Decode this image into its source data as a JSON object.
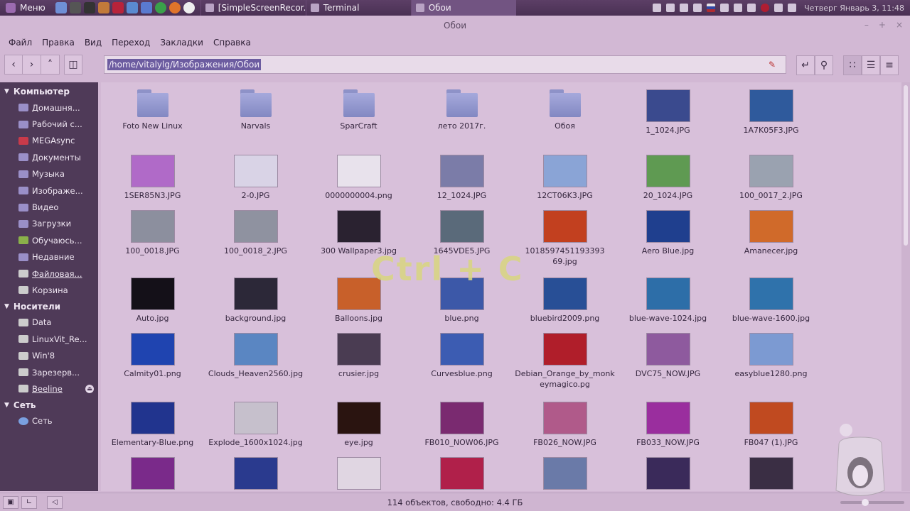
{
  "panel": {
    "menu_label": "Меню",
    "tasks": [
      {
        "label": "[SimpleScreenRecor..."
      },
      {
        "label": "Terminal"
      },
      {
        "label": "Обои"
      }
    ],
    "clock": "Четверг Январь 3, 11:48"
  },
  "window": {
    "title": "Обои",
    "controls": [
      "–",
      "+",
      "×"
    ]
  },
  "menubar": [
    "Файл",
    "Правка",
    "Вид",
    "Переход",
    "Закладки",
    "Справка"
  ],
  "toolbar": {
    "path": "/home/vitalylg/Изображения/Обои"
  },
  "sidebar": {
    "sections": [
      {
        "title": "Компьютер",
        "items": [
          "Домашня...",
          "Рабочий с...",
          "MEGAsync",
          "Документы",
          "Музыка",
          "Изображе...",
          "Видео",
          "Загрузки",
          "Обучаюсь...",
          "Недавние",
          "Файловая...",
          "Корзина"
        ]
      },
      {
        "title": "Носители",
        "items": [
          "Data",
          "LinuxVit_Re...",
          "Win'8",
          "Зарезерв...",
          "Beeline"
        ]
      },
      {
        "title": "Сеть",
        "items": [
          "Сеть"
        ]
      }
    ]
  },
  "files": [
    {
      "name": "Foto New Linux",
      "kind": "folder"
    },
    {
      "name": "Narvals",
      "kind": "folder"
    },
    {
      "name": "SparCraft",
      "kind": "folder"
    },
    {
      "name": "лето 2017г.",
      "kind": "folder"
    },
    {
      "name": "Обоя",
      "kind": "folder"
    },
    {
      "name": "1_1024.JPG",
      "kind": "image",
      "color": "#3a4a8e"
    },
    {
      "name": "1A7K05F3.JPG",
      "kind": "image",
      "color": "#2f5a9c"
    },
    {
      "name": "1SER85N3.JPG",
      "kind": "image",
      "color": "#b06ac8"
    },
    {
      "name": "2-0.JPG",
      "kind": "image",
      "color": "#d9d3e6"
    },
    {
      "name": "0000000004.png",
      "kind": "image",
      "color": "#e8e2ec"
    },
    {
      "name": "12_1024.JPG",
      "kind": "image",
      "color": "#7b7ca8"
    },
    {
      "name": "12CT06K3.JPG",
      "kind": "image",
      "color": "#8aa4d6"
    },
    {
      "name": "20_1024.JPG",
      "kind": "image",
      "color": "#5f9a52"
    },
    {
      "name": "100_0017_2.JPG",
      "kind": "image",
      "color": "#9aa2b0"
    },
    {
      "name": "100_0018.JPG",
      "kind": "image",
      "color": "#8c8f9e"
    },
    {
      "name": "100_0018_2.JPG",
      "kind": "image",
      "color": "#8f92a0"
    },
    {
      "name": "300 Wallpaper3.jpg",
      "kind": "image",
      "color": "#2a2230"
    },
    {
      "name": "1645VDE5.JPG",
      "kind": "image",
      "color": "#5a6a7a"
    },
    {
      "name": "1018597451193393 69.jpg",
      "kind": "image",
      "color": "#c2401f"
    },
    {
      "name": "Aero Blue.jpg",
      "kind": "image",
      "color": "#1f3f8e"
    },
    {
      "name": "Amanecer.jpg",
      "kind": "image",
      "color": "#d06a2a"
    },
    {
      "name": "Auto.jpg",
      "kind": "image",
      "color": "#141018"
    },
    {
      "name": "background.jpg",
      "kind": "image",
      "color": "#2c2838"
    },
    {
      "name": "Balloons.jpg",
      "kind": "image",
      "color": "#c8602a"
    },
    {
      "name": "blue.png",
      "kind": "image",
      "color": "#3c58a8"
    },
    {
      "name": "bluebird2009.png",
      "kind": "image",
      "color": "#284f96"
    },
    {
      "name": "blue-wave-1024.jpg",
      "kind": "image",
      "color": "#2d6ea8"
    },
    {
      "name": "blue-wave-1600.jpg",
      "kind": "image",
      "color": "#2f72ab"
    },
    {
      "name": "Calmity01.png",
      "kind": "image",
      "color": "#1f44b0"
    },
    {
      "name": "Clouds_Heaven2560.jpg",
      "kind": "image",
      "color": "#5a86c2"
    },
    {
      "name": "crusier.jpg",
      "kind": "image",
      "color": "#4a3c52"
    },
    {
      "name": "Curvesblue.png",
      "kind": "image",
      "color": "#3c5cb2"
    },
    {
      "name": "Debian_Orange_by_monkeymagico.pg",
      "kind": "image",
      "color": "#b01e2a"
    },
    {
      "name": "DVC75_NOW.JPG",
      "kind": "image",
      "color": "#8e5a9e"
    },
    {
      "name": "easyblue1280.png",
      "kind": "image",
      "color": "#7c9ad2"
    },
    {
      "name": "Elementary-Blue.png",
      "kind": "image",
      "color": "#21348e"
    },
    {
      "name": "Explode_1600x1024.jpg",
      "kind": "image",
      "color": "#c6c0cc"
    },
    {
      "name": "eye.jpg",
      "kind": "image",
      "color": "#2a1410"
    },
    {
      "name": "FB010_NOW06.JPG",
      "kind": "image",
      "color": "#7a2a70"
    },
    {
      "name": "FB026_NOW.JPG",
      "kind": "image",
      "color": "#b05a8a"
    },
    {
      "name": "FB033_NOW.JPG",
      "kind": "image",
      "color": "#9a2e9e"
    },
    {
      "name": "FB047 (1).JPG",
      "kind": "image",
      "color": "#c04a20"
    },
    {
      "name": "",
      "kind": "image",
      "color": "#7a2a8a"
    },
    {
      "name": "",
      "kind": "image",
      "color": "#2a3a8e"
    },
    {
      "name": "",
      "kind": "image",
      "color": "#e0d6e2"
    },
    {
      "name": "",
      "kind": "image",
      "color": "#b0204a"
    },
    {
      "name": "",
      "kind": "image",
      "color": "#6a7aa8"
    },
    {
      "name": "",
      "kind": "image",
      "color": "#3a2a5a"
    },
    {
      "name": "",
      "kind": "image",
      "color": "#3a2e44"
    }
  ],
  "overlay_keys": "Ctrl + C",
  "status": "114 объектов, свободно: 4.4 ГБ"
}
